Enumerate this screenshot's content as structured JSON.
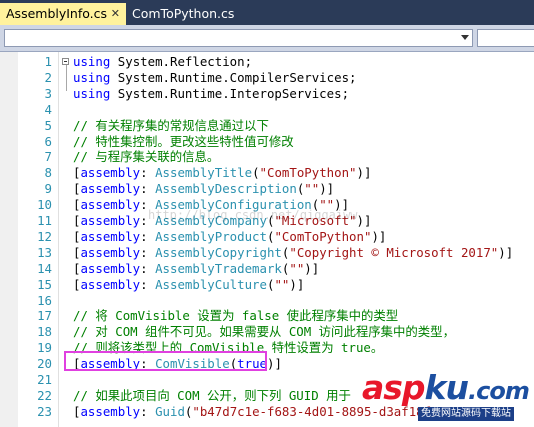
{
  "tabs": [
    {
      "label": "AssemblyInfo.cs",
      "close": "✕",
      "active": true
    },
    {
      "label": "ComToPython.cs",
      "active": false
    }
  ],
  "lines": [
    {
      "n": "1",
      "fold": true,
      "parts": [
        [
          "kw",
          "using"
        ],
        [
          "pl",
          " System.Reflection;"
        ]
      ]
    },
    {
      "n": "2",
      "parts": [
        [
          "kw",
          "using"
        ],
        [
          "pl",
          " System.Runtime.CompilerServices;"
        ]
      ]
    },
    {
      "n": "3",
      "parts": [
        [
          "kw",
          "using"
        ],
        [
          "pl",
          " System.Runtime.InteropServices;"
        ]
      ]
    },
    {
      "n": "4",
      "parts": []
    },
    {
      "n": "5",
      "parts": [
        [
          "cm",
          "// 有关程序集的常规信息通过以下"
        ]
      ]
    },
    {
      "n": "6",
      "parts": [
        [
          "cm",
          "// 特性集控制。更改这些特性值可修改"
        ]
      ]
    },
    {
      "n": "7",
      "parts": [
        [
          "cm",
          "// 与程序集关联的信息。"
        ]
      ]
    },
    {
      "n": "8",
      "parts": [
        [
          "pl",
          "["
        ],
        [
          "kw",
          "assembly"
        ],
        [
          "pl",
          ": "
        ],
        [
          "ty",
          "AssemblyTitle"
        ],
        [
          "pl",
          "("
        ],
        [
          "st",
          "\"ComToPython\""
        ],
        [
          "pl",
          ")]"
        ]
      ]
    },
    {
      "n": "9",
      "parts": [
        [
          "pl",
          "["
        ],
        [
          "kw",
          "assembly"
        ],
        [
          "pl",
          ": "
        ],
        [
          "ty",
          "AssemblyDescription"
        ],
        [
          "pl",
          "("
        ],
        [
          "st",
          "\"\""
        ],
        [
          "pl",
          ")]"
        ]
      ]
    },
    {
      "n": "10",
      "parts": [
        [
          "pl",
          "["
        ],
        [
          "kw",
          "assembly"
        ],
        [
          "pl",
          ": "
        ],
        [
          "ty",
          "AssemblyConfiguration"
        ],
        [
          "pl",
          "("
        ],
        [
          "st",
          "\"\""
        ],
        [
          "pl",
          ")]"
        ]
      ]
    },
    {
      "n": "11",
      "parts": [
        [
          "pl",
          "["
        ],
        [
          "kw",
          "assembly"
        ],
        [
          "pl",
          ": "
        ],
        [
          "ty",
          "AssemblyCompany"
        ],
        [
          "pl",
          "("
        ],
        [
          "st",
          "\"Microsoft\""
        ],
        [
          "pl",
          ")]"
        ]
      ]
    },
    {
      "n": "12",
      "parts": [
        [
          "pl",
          "["
        ],
        [
          "kw",
          "assembly"
        ],
        [
          "pl",
          ": "
        ],
        [
          "ty",
          "AssemblyProduct"
        ],
        [
          "pl",
          "("
        ],
        [
          "st",
          "\"ComToPython\""
        ],
        [
          "pl",
          ")]"
        ]
      ]
    },
    {
      "n": "13",
      "parts": [
        [
          "pl",
          "["
        ],
        [
          "kw",
          "assembly"
        ],
        [
          "pl",
          ": "
        ],
        [
          "ty",
          "AssemblyCopyright"
        ],
        [
          "pl",
          "("
        ],
        [
          "st",
          "\"Copyright © Microsoft 2017\""
        ],
        [
          "pl",
          ")]"
        ]
      ]
    },
    {
      "n": "14",
      "parts": [
        [
          "pl",
          "["
        ],
        [
          "kw",
          "assembly"
        ],
        [
          "pl",
          ": "
        ],
        [
          "ty",
          "AssemblyTrademark"
        ],
        [
          "pl",
          "("
        ],
        [
          "st",
          "\"\""
        ],
        [
          "pl",
          ")]"
        ]
      ]
    },
    {
      "n": "15",
      "parts": [
        [
          "pl",
          "["
        ],
        [
          "kw",
          "assembly"
        ],
        [
          "pl",
          ": "
        ],
        [
          "ty",
          "AssemblyCulture"
        ],
        [
          "pl",
          "("
        ],
        [
          "st",
          "\"\""
        ],
        [
          "pl",
          ")]"
        ]
      ]
    },
    {
      "n": "16",
      "parts": []
    },
    {
      "n": "17",
      "parts": [
        [
          "cm",
          "// 将 ComVisible 设置为 false 使此程序集中的类型"
        ]
      ]
    },
    {
      "n": "18",
      "parts": [
        [
          "cm",
          "// 对 COM 组件不可见。如果需要从 COM 访问此程序集中的类型，"
        ]
      ]
    },
    {
      "n": "19",
      "parts": [
        [
          "cm",
          "// 则将该类型上的 ComVisible 特性设置为 true。"
        ]
      ]
    },
    {
      "n": "20",
      "parts": [
        [
          "pl",
          "["
        ],
        [
          "kw",
          "assembly"
        ],
        [
          "pl",
          ": "
        ],
        [
          "ty",
          "ComVisible"
        ],
        [
          "pl",
          "("
        ],
        [
          "kw",
          "true"
        ],
        [
          "pl",
          ")]"
        ]
      ]
    },
    {
      "n": "21",
      "parts": []
    },
    {
      "n": "22",
      "parts": [
        [
          "cm",
          "// 如果此项目向 COM 公开，则下列 GUID 用于"
        ]
      ]
    },
    {
      "n": "23",
      "parts": [
        [
          "pl",
          "["
        ],
        [
          "kw",
          "assembly"
        ],
        [
          "pl",
          ": "
        ],
        [
          "ty",
          "Guid"
        ],
        [
          "pl",
          "("
        ],
        [
          "st",
          "\"b47d7c1e-f683-4d01-8895-d3af18f6"
        ]
      ]
    }
  ],
  "watermark": "http://blog.csdn.net/qiqqaiww",
  "brand": {
    "part1": "asp",
    "part2": "ku",
    "part3": ".com",
    "sub": "免费网站源码下载站"
  },
  "colors": {
    "keyword": "#0000ff",
    "type": "#2b91af",
    "string": "#a31515",
    "comment": "#008000",
    "highlight": "#e040e0"
  }
}
